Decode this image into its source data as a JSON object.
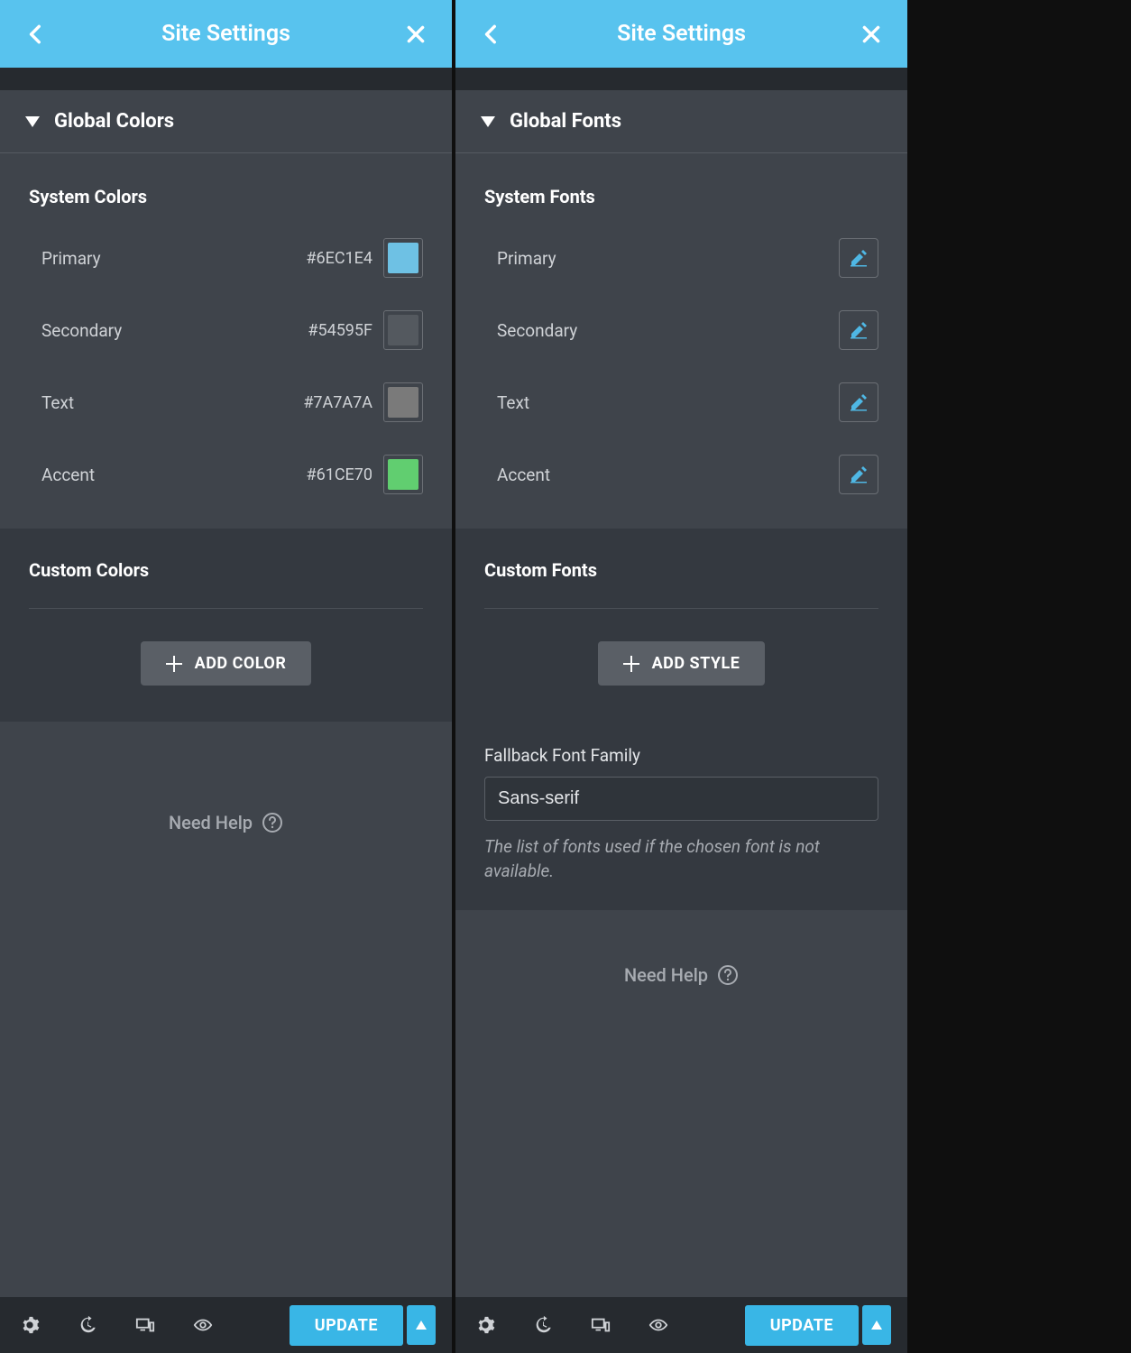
{
  "header_title": "Site Settings",
  "left": {
    "section_title": "Global Colors",
    "system_heading": "System Colors",
    "colors": [
      {
        "label": "Primary",
        "hex": "#6EC1E4",
        "swatch": "#6EC1E4"
      },
      {
        "label": "Secondary",
        "hex": "#54595F",
        "swatch": "#54595F"
      },
      {
        "label": "Text",
        "hex": "#7A7A7A",
        "swatch": "#7A7A7A"
      },
      {
        "label": "Accent",
        "hex": "#61CE70",
        "swatch": "#61CE70"
      }
    ],
    "custom_heading": "Custom Colors",
    "add_label": "ADD COLOR",
    "need_help": "Need Help"
  },
  "right": {
    "section_title": "Global Fonts",
    "system_heading": "System Fonts",
    "fonts": [
      {
        "label": "Primary"
      },
      {
        "label": "Secondary"
      },
      {
        "label": "Text"
      },
      {
        "label": "Accent"
      }
    ],
    "custom_heading": "Custom Fonts",
    "add_label": "ADD STYLE",
    "fallback_label": "Fallback Font Family",
    "fallback_value": "Sans-serif",
    "fallback_desc": "The list of fonts used if the chosen font is not available.",
    "need_help": "Need Help"
  },
  "footer_update": "UPDATE"
}
